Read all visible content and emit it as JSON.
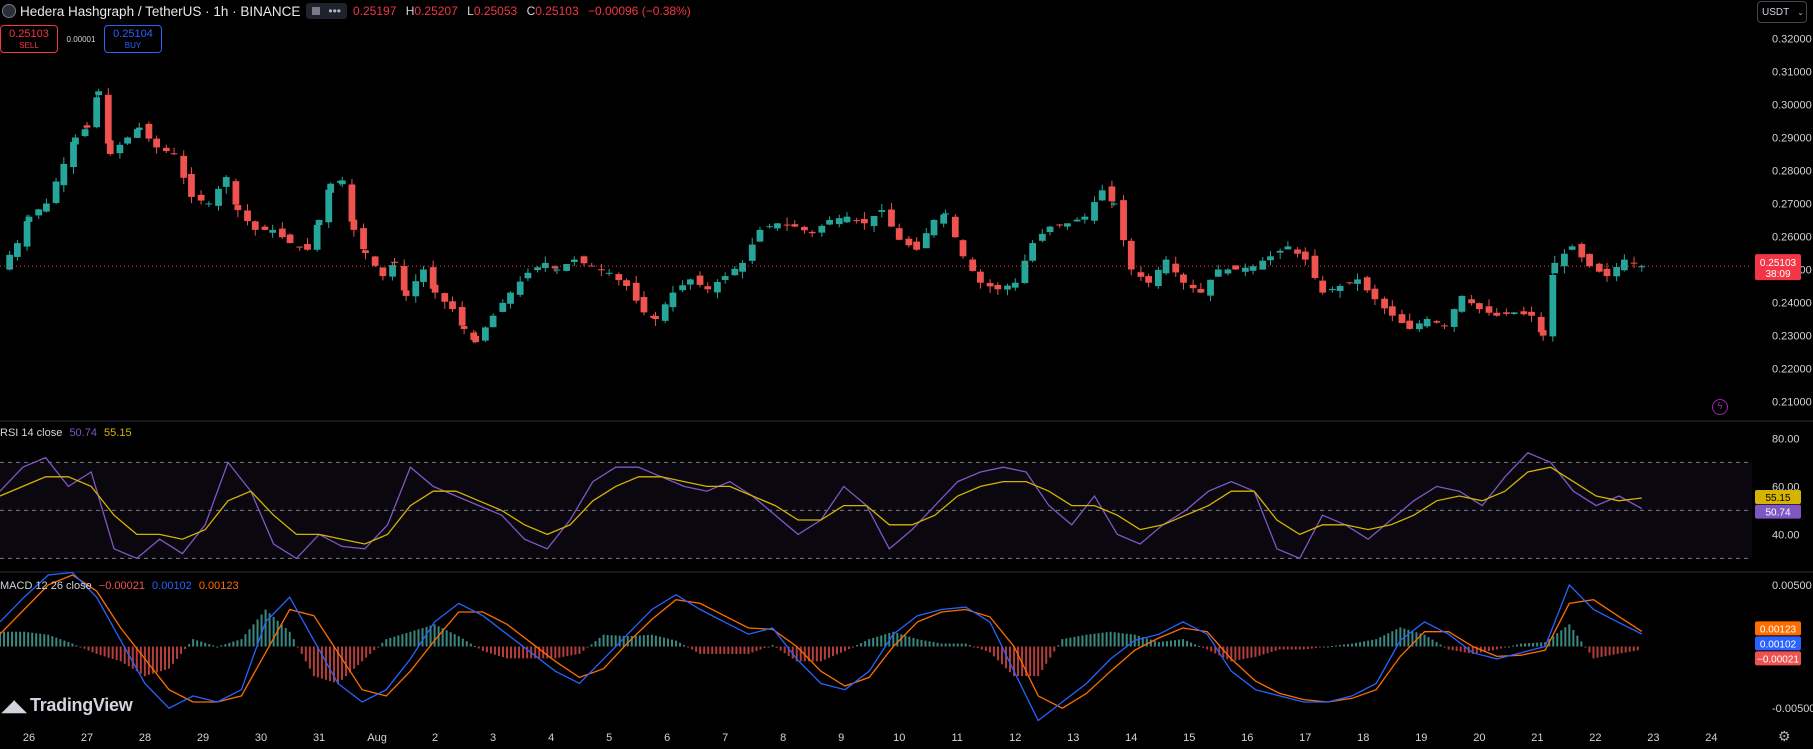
{
  "header": {
    "symbol_title": "Hedera Hashgraph / TetherUS · 1h · BINANCE",
    "more_icon": "ellipsis-icon",
    "ohlc_open_value": "0.25197",
    "ohlc_high_label": "H",
    "ohlc_high_value": "0.25207",
    "ohlc_low_label": "L",
    "ohlc_low_value": "0.25053",
    "ohlc_close_label": "C",
    "ohlc_close_value": "0.25103",
    "ohlc_change": "−0.00096 (−0.38%)"
  },
  "trade": {
    "sell_price": "0.25103",
    "sell_label": "SELL",
    "spread": "0.00001",
    "buy_price": "0.25104",
    "buy_label": "BUY"
  },
  "currency": {
    "label": "USDT"
  },
  "brand": {
    "name": "TradingView"
  },
  "colors": {
    "up": "#26a69a",
    "down": "#ef5350",
    "rsi": "#7e57c2",
    "rsi_ma": "#d4b400",
    "macd": "#2962ff",
    "signal": "#ff6d00",
    "price_line": "#f23645"
  },
  "chart_data": [
    {
      "type": "candlestick",
      "title": "Hedera Hashgraph / TetherUS · 1h · BINANCE",
      "ylim": [
        0.205,
        0.325
      ],
      "yticks": [
        "0.32000",
        "0.31000",
        "0.30000",
        "0.29000",
        "0.28000",
        "0.27000",
        "0.26000",
        "0.25000",
        "0.24000",
        "0.23000",
        "0.22000",
        "0.21000"
      ],
      "last_price_label": "0.25103",
      "countdown_label": "38:09",
      "x_labels": [
        "26",
        "27",
        "28",
        "29",
        "30",
        "31",
        "Aug",
        "2",
        "3",
        "4",
        "5",
        "6",
        "7",
        "8",
        "9",
        "10",
        "11",
        "12",
        "13",
        "14",
        "15",
        "16",
        "17",
        "18",
        "19",
        "20",
        "21",
        "22",
        "23",
        "24"
      ],
      "x_days": [
        26,
        27,
        28,
        29,
        30,
        31,
        32,
        33,
        34,
        35,
        36,
        37,
        38,
        39,
        40,
        41,
        42,
        43,
        44,
        45,
        46,
        47,
        48,
        49,
        50,
        51,
        52,
        53,
        54,
        55
      ],
      "xlim": [
        25.5,
        55.7
      ],
      "close_path": [
        [
          25.5,
          0.25
        ],
        [
          25.8,
          0.258
        ],
        [
          26.0,
          0.266
        ],
        [
          26.3,
          0.27
        ],
        [
          26.6,
          0.282
        ],
        [
          26.8,
          0.29
        ],
        [
          27.0,
          0.293
        ],
        [
          27.2,
          0.304
        ],
        [
          27.4,
          0.285
        ],
        [
          27.7,
          0.29
        ],
        [
          27.9,
          0.293
        ],
        [
          28.2,
          0.287
        ],
        [
          28.5,
          0.285
        ],
        [
          28.8,
          0.272
        ],
        [
          29.1,
          0.27
        ],
        [
          29.4,
          0.278
        ],
        [
          29.6,
          0.268
        ],
        [
          29.9,
          0.262
        ],
        [
          30.2,
          0.262
        ],
        [
          30.5,
          0.258
        ],
        [
          30.8,
          0.256
        ],
        [
          31.0,
          0.265
        ],
        [
          31.2,
          0.276
        ],
        [
          31.4,
          0.277
        ],
        [
          31.6,
          0.262
        ],
        [
          31.8,
          0.255
        ],
        [
          32.1,
          0.248
        ],
        [
          32.3,
          0.252
        ],
        [
          32.5,
          0.242
        ],
        [
          32.8,
          0.25
        ],
        [
          33.0,
          0.243
        ],
        [
          33.3,
          0.238
        ],
        [
          33.5,
          0.232
        ],
        [
          33.7,
          0.228
        ],
        [
          34.0,
          0.236
        ],
        [
          34.3,
          0.243
        ],
        [
          34.6,
          0.249
        ],
        [
          34.9,
          0.252
        ],
        [
          35.1,
          0.25
        ],
        [
          35.4,
          0.253
        ],
        [
          35.7,
          0.251
        ],
        [
          36.0,
          0.249
        ],
        [
          36.3,
          0.245
        ],
        [
          36.6,
          0.237
        ],
        [
          36.8,
          0.235
        ],
        [
          37.1,
          0.243
        ],
        [
          37.4,
          0.247
        ],
        [
          37.7,
          0.244
        ],
        [
          38.0,
          0.248
        ],
        [
          38.3,
          0.252
        ],
        [
          38.6,
          0.262
        ],
        [
          38.9,
          0.264
        ],
        [
          39.2,
          0.263
        ],
        [
          39.5,
          0.261
        ],
        [
          39.8,
          0.265
        ],
        [
          40.1,
          0.266
        ],
        [
          40.4,
          0.264
        ],
        [
          40.7,
          0.268
        ],
        [
          41.0,
          0.259
        ],
        [
          41.3,
          0.256
        ],
        [
          41.6,
          0.265
        ],
        [
          41.8,
          0.267
        ],
        [
          42.1,
          0.254
        ],
        [
          42.4,
          0.246
        ],
        [
          42.7,
          0.244
        ],
        [
          43.0,
          0.246
        ],
        [
          43.3,
          0.258
        ],
        [
          43.6,
          0.263
        ],
        [
          43.9,
          0.264
        ],
        [
          44.2,
          0.266
        ],
        [
          44.5,
          0.274
        ],
        [
          44.7,
          0.27
        ],
        [
          45.0,
          0.25
        ],
        [
          45.3,
          0.246
        ],
        [
          45.6,
          0.253
        ],
        [
          45.9,
          0.246
        ],
        [
          46.2,
          0.243
        ],
        [
          46.5,
          0.25
        ],
        [
          46.8,
          0.25
        ],
        [
          47.1,
          0.251
        ],
        [
          47.4,
          0.254
        ],
        [
          47.7,
          0.257
        ],
        [
          48.0,
          0.253
        ],
        [
          48.3,
          0.243
        ],
        [
          48.6,
          0.245
        ],
        [
          48.9,
          0.247
        ],
        [
          49.2,
          0.241
        ],
        [
          49.5,
          0.236
        ],
        [
          49.8,
          0.232
        ],
        [
          50.1,
          0.235
        ],
        [
          50.4,
          0.233
        ],
        [
          50.7,
          0.242
        ],
        [
          51.0,
          0.238
        ],
        [
          51.3,
          0.236
        ],
        [
          51.6,
          0.237
        ],
        [
          51.9,
          0.236
        ],
        [
          52.1,
          0.23
        ],
        [
          52.3,
          0.252
        ],
        [
          52.6,
          0.257
        ],
        [
          52.9,
          0.251
        ],
        [
          53.2,
          0.248
        ],
        [
          53.5,
          0.253
        ],
        [
          53.8,
          0.25103
        ]
      ]
    },
    {
      "type": "line",
      "title": "RSI 14 close",
      "legend_rsi": "50.74",
      "legend_ma": "55.15",
      "ylim": [
        26,
        86
      ],
      "yticks": [
        "80.00",
        "60.00",
        "40.00"
      ],
      "bands": [
        70,
        50,
        30
      ],
      "series": [
        {
          "name": "RSI",
          "values": [
            58,
            68,
            72,
            60,
            66,
            34,
            30,
            38,
            32,
            44,
            70,
            58,
            36,
            30,
            40,
            35,
            34,
            44,
            68,
            60,
            56,
            52,
            48,
            38,
            34,
            46,
            62,
            68,
            68,
            64,
            60,
            58,
            62,
            56,
            48,
            40,
            46,
            60,
            52,
            34,
            42,
            52,
            62,
            66,
            68,
            66,
            52,
            44,
            56,
            40,
            36,
            44,
            50,
            58,
            62,
            58,
            34,
            30,
            48,
            44,
            38,
            46,
            54,
            60,
            58,
            52,
            64,
            74,
            70,
            58,
            52,
            56,
            50.74
          ]
        },
        {
          "name": "RSI-based MA",
          "values": [
            56,
            60,
            64,
            64,
            60,
            48,
            40,
            40,
            38,
            42,
            54,
            58,
            48,
            40,
            40,
            38,
            36,
            40,
            52,
            58,
            58,
            54,
            50,
            44,
            40,
            44,
            54,
            60,
            64,
            64,
            62,
            60,
            60,
            56,
            52,
            46,
            46,
            52,
            52,
            44,
            44,
            48,
            56,
            60,
            62,
            62,
            58,
            52,
            52,
            48,
            42,
            44,
            48,
            52,
            58,
            58,
            46,
            40,
            44,
            44,
            42,
            44,
            48,
            54,
            56,
            54,
            58,
            66,
            68,
            62,
            56,
            54,
            55.15
          ]
        }
      ]
    },
    {
      "type": "line",
      "title": "MACD 12 26 close",
      "legend_hist": "−0.00021",
      "legend_macd": "0.00102",
      "legend_signal": "0.00123",
      "ylim": [
        -0.0062,
        0.0058
      ],
      "yticks": [
        "0.00500",
        "-0.00500"
      ],
      "series": [
        {
          "name": "MACD",
          "values": [
            0.002,
            0.004,
            0.0058,
            0.006,
            0.004,
            0.0005,
            -0.003,
            -0.005,
            -0.004,
            -0.0045,
            -0.0035,
            0.002,
            0.004,
            0.0005,
            -0.003,
            -0.0045,
            -0.0035,
            -0.001,
            0.002,
            0.0035,
            0.0025,
            0.001,
            -0.0005,
            -0.002,
            -0.003,
            -0.001,
            0.001,
            0.003,
            0.0042,
            0.003,
            0.002,
            0.001,
            0.0015,
            -0.001,
            -0.003,
            -0.0035,
            -0.002,
            0.001,
            0.0025,
            0.003,
            0.0032,
            0.002,
            -0.002,
            -0.006,
            -0.0045,
            -0.003,
            -0.001,
            0.0005,
            0.001,
            0.002,
            0.001,
            -0.002,
            -0.0035,
            -0.004,
            -0.0045,
            -0.0045,
            -0.004,
            -0.003,
            0.0005,
            0.002,
            0.001,
            -0.0005,
            -0.001,
            -0.0005,
            0.0,
            0.005,
            0.003,
            0.002,
            0.00102
          ]
        },
        {
          "name": "Signal",
          "values": [
            0.001,
            0.003,
            0.005,
            0.0058,
            0.0045,
            0.0015,
            -0.001,
            -0.0035,
            -0.0045,
            -0.0045,
            -0.004,
            -0.0005,
            0.003,
            0.0025,
            -0.0005,
            -0.0035,
            -0.004,
            -0.002,
            0.0005,
            0.0028,
            0.0028,
            0.0018,
            0.0003,
            -0.0012,
            -0.0025,
            -0.0018,
            0.0003,
            0.0022,
            0.0038,
            0.0035,
            0.0025,
            0.0015,
            0.0014,
            0.0,
            -0.002,
            -0.0032,
            -0.0025,
            0.0,
            0.002,
            0.0028,
            0.003,
            0.0024,
            0.0,
            -0.004,
            -0.005,
            -0.0038,
            -0.002,
            -0.0003,
            0.0007,
            0.0015,
            0.0012,
            -0.001,
            -0.0028,
            -0.0038,
            -0.0043,
            -0.0045,
            -0.0042,
            -0.0035,
            -0.0008,
            0.0012,
            0.0012,
            0.0,
            -0.0008,
            -0.0007,
            -0.0003,
            0.0035,
            0.0038,
            0.0025,
            0.00123
          ]
        }
      ]
    }
  ]
}
